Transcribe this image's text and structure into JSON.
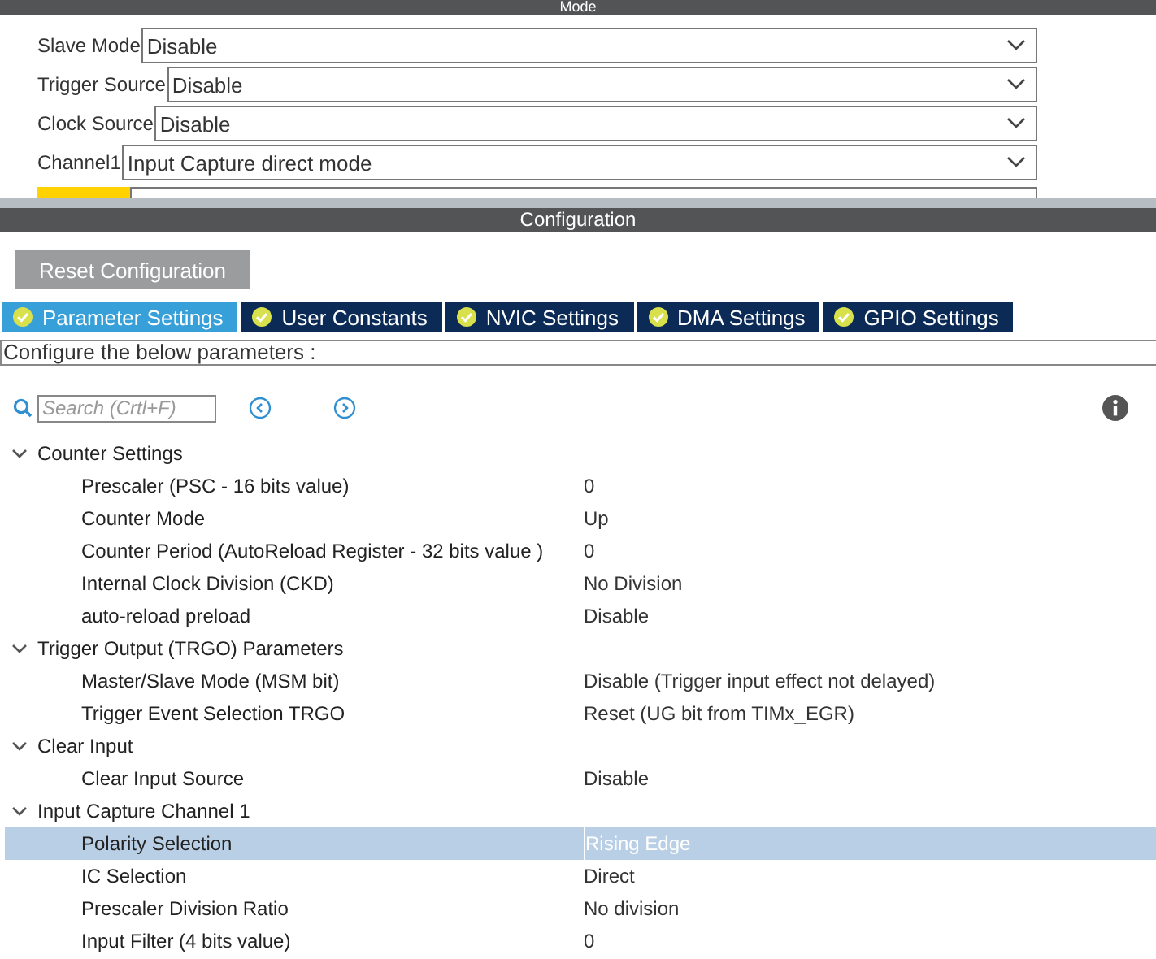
{
  "mode": {
    "title": "Mode",
    "fields": [
      {
        "label": "Slave Mode",
        "value": "Disable"
      },
      {
        "label": "Trigger Source",
        "value": "Disable"
      },
      {
        "label": "Clock Source",
        "value": "Disable"
      },
      {
        "label": "Channel1",
        "value": "Input Capture direct mode"
      }
    ]
  },
  "configuration": {
    "title": "Configuration",
    "reset_button": "Reset Configuration",
    "tabs": [
      {
        "label": "Parameter Settings",
        "selected": true
      },
      {
        "label": "User Constants",
        "selected": false
      },
      {
        "label": "NVIC Settings",
        "selected": false
      },
      {
        "label": "DMA Settings",
        "selected": false
      },
      {
        "label": "GPIO Settings",
        "selected": false
      }
    ],
    "description": "Configure the below parameters :",
    "search": {
      "placeholder": "Search (Crtl+F)"
    },
    "groups": [
      {
        "label": "Counter Settings",
        "expanded": true,
        "children": [
          {
            "label": "Prescaler (PSC - 16 bits value)",
            "value": "0",
            "selected": false
          },
          {
            "label": "Counter Mode",
            "value": "Up",
            "selected": false
          },
          {
            "label": "Counter Period (AutoReload Register - 32 bits value )",
            "value": "0",
            "selected": false
          },
          {
            "label": "Internal Clock Division (CKD)",
            "value": "No Division",
            "selected": false
          },
          {
            "label": "auto-reload preload",
            "value": "Disable",
            "selected": false
          }
        ]
      },
      {
        "label": "Trigger Output (TRGO) Parameters",
        "expanded": true,
        "children": [
          {
            "label": "Master/Slave Mode (MSM bit)",
            "value": "Disable (Trigger input effect not delayed)",
            "selected": false
          },
          {
            "label": "Trigger Event Selection TRGO",
            "value": "Reset (UG bit from TIMx_EGR)",
            "selected": false
          }
        ]
      },
      {
        "label": "Clear Input",
        "expanded": true,
        "children": [
          {
            "label": "Clear Input Source",
            "value": "Disable",
            "selected": false
          }
        ]
      },
      {
        "label": "Input Capture Channel 1",
        "expanded": true,
        "children": [
          {
            "label": "Polarity Selection",
            "value": "Rising Edge",
            "selected": true
          },
          {
            "label": "IC Selection",
            "value": "Direct",
            "selected": false
          },
          {
            "label": "Prescaler Division Ratio",
            "value": "No division",
            "selected": false
          },
          {
            "label": "Input Filter (4 bits value)",
            "value": "0",
            "selected": false
          }
        ]
      }
    ]
  }
}
